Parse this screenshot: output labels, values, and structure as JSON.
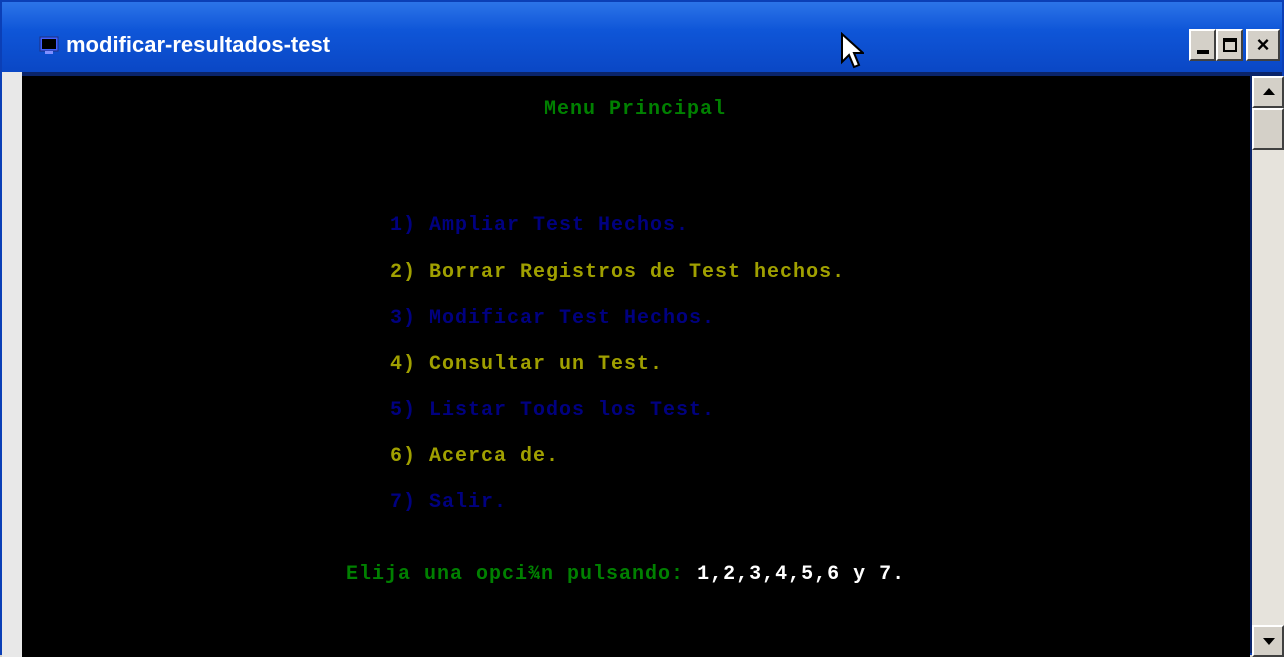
{
  "window": {
    "title": "modificar-resultados-test",
    "icon": "console-app-icon",
    "controls": {
      "minimize": "minimize-icon",
      "maximize": "maximize-icon",
      "close_label": "×"
    }
  },
  "console": {
    "heading": "Menu Principal",
    "menu": [
      {
        "label": "1) Ampliar Test Hechos.",
        "color": "#000080"
      },
      {
        "label": "2) Borrar Registros de Test hechos.",
        "color": "#a0a000"
      },
      {
        "label": "3) Modificar Test Hechos.",
        "color": "#000080"
      },
      {
        "label": "4) Consultar un Test.",
        "color": "#a0a000"
      },
      {
        "label": "5) Listar Todos los Test.",
        "color": "#000080"
      },
      {
        "label": "6) Acerca de.",
        "color": "#a0a000"
      },
      {
        "label": "7) Salir.",
        "color": "#000080"
      }
    ],
    "prompt": "Elija una opci¾n pulsando:",
    "prompt_keys": "1,2,3,4,5,6 y 7."
  },
  "colors": {
    "console_bg": "#000000",
    "heading": "#008000",
    "titlebar": "#0f56d8"
  }
}
